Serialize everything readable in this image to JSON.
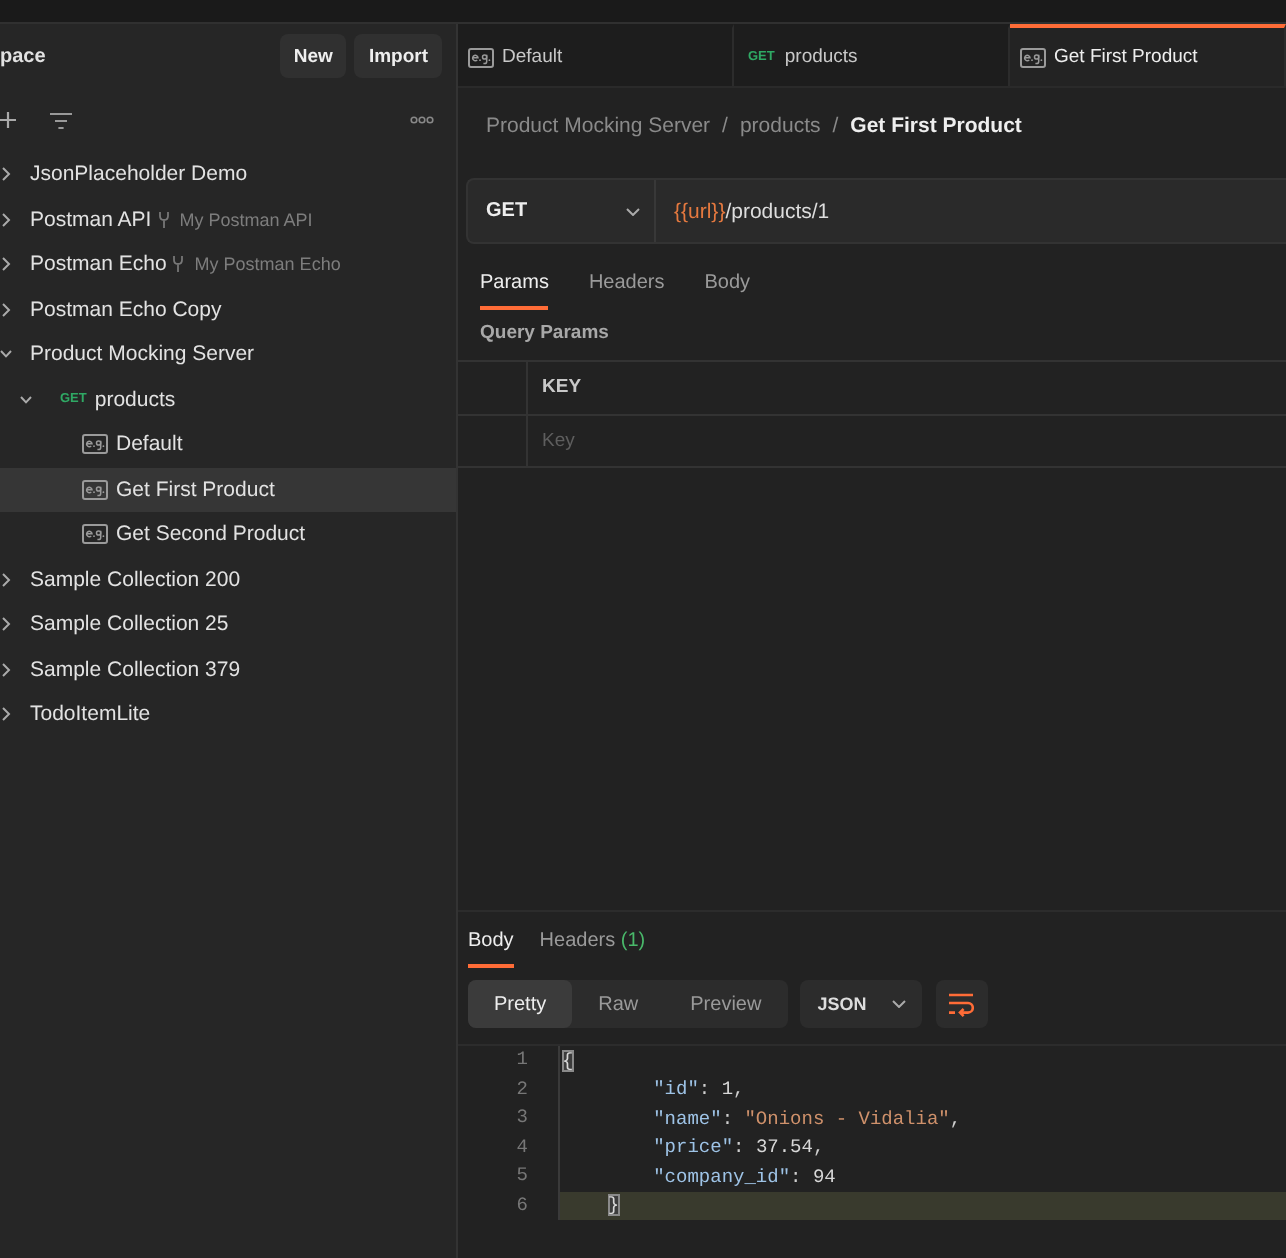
{
  "sidebar": {
    "title": "pace",
    "buttons": [
      "New",
      "Import"
    ],
    "items": [
      {
        "kind": "collection",
        "label": "JsonPlaceholder Demo",
        "expanded": false,
        "selected": false
      },
      {
        "kind": "collection",
        "label": "Postman API",
        "fork_label": "My Postman API",
        "expanded": false,
        "selected": false
      },
      {
        "kind": "collection",
        "label": "Postman Echo",
        "fork_label": "My Postman Echo",
        "expanded": false,
        "selected": false
      },
      {
        "kind": "collection",
        "label": "Postman Echo Copy",
        "expanded": false,
        "selected": false
      },
      {
        "kind": "collection",
        "label": "Product Mocking Server",
        "expanded": true,
        "selected": false,
        "children": [
          {
            "kind": "request",
            "method": "GET",
            "label": "products",
            "expanded": true,
            "selected": false,
            "children": [
              {
                "kind": "example",
                "label": "Default",
                "selected": false
              },
              {
                "kind": "example",
                "label": "Get First Product",
                "selected": true
              },
              {
                "kind": "example",
                "label": "Get Second Product",
                "selected": false
              }
            ]
          }
        ]
      },
      {
        "kind": "collection",
        "label": "Sample Collection 200",
        "expanded": false,
        "selected": false
      },
      {
        "kind": "collection",
        "label": "Sample Collection 25",
        "expanded": false,
        "selected": false
      },
      {
        "kind": "collection",
        "label": "Sample Collection 379",
        "expanded": false,
        "selected": false
      },
      {
        "kind": "collection",
        "label": "TodoItemLite",
        "expanded": false,
        "selected": false
      }
    ]
  },
  "tabs": [
    {
      "kind": "example",
      "label": "Default",
      "selected": false
    },
    {
      "kind": "request",
      "method": "GET",
      "label": "products",
      "selected": false
    },
    {
      "kind": "example",
      "label": "Get First Product",
      "selected": true
    }
  ],
  "breadcrumb": [
    {
      "label": "Product Mocking Server",
      "separator": "/"
    },
    {
      "label": "products",
      "separator": "/"
    },
    {
      "label": "Get First Product"
    }
  ],
  "request": {
    "method": "GET",
    "url": [
      {
        "kind": "variable",
        "text": "{{url}}"
      },
      {
        "kind": "path",
        "text": "/products/1"
      }
    ],
    "tabs": [
      {
        "label": "Params",
        "selected": true
      },
      {
        "label": "Headers",
        "selected": false
      },
      {
        "label": "Body",
        "selected": false
      }
    ],
    "section_title": "Query Params",
    "params_table": {
      "columns": [
        "KEY"
      ],
      "rows": [
        {
          "key_placeholder": "Key"
        }
      ]
    }
  },
  "response": {
    "tabs": [
      {
        "label": "Body",
        "selected": true
      },
      {
        "label": "Headers",
        "count": "(1)",
        "selected": false
      }
    ],
    "views": [
      {
        "label": "Pretty",
        "selected": true
      },
      {
        "label": "Raw",
        "selected": false
      },
      {
        "label": "Preview",
        "selected": false
      }
    ],
    "format": "JSON",
    "wrap_lines": true,
    "code": [
      {
        "number": "1",
        "highlighted": false,
        "tokens": [
          {
            "kind": "bracket",
            "text": "{",
            "matched": true
          }
        ]
      },
      {
        "number": "2",
        "highlighted": false,
        "tokens": [
          {
            "kind": "key",
            "text": "\t\t\"id\""
          },
          {
            "kind": "punct",
            "text": ": "
          },
          {
            "kind": "number",
            "text": "1"
          },
          {
            "kind": "punct",
            "text": ","
          }
        ]
      },
      {
        "number": "3",
        "highlighted": false,
        "tokens": [
          {
            "kind": "key",
            "text": "\t\t\"name\""
          },
          {
            "kind": "punct",
            "text": ": "
          },
          {
            "kind": "string",
            "text": "\"Onions - Vidalia\""
          },
          {
            "kind": "punct",
            "text": ","
          }
        ]
      },
      {
        "number": "4",
        "highlighted": false,
        "tokens": [
          {
            "kind": "key",
            "text": "\t\t\"price\""
          },
          {
            "kind": "punct",
            "text": ": "
          },
          {
            "kind": "number",
            "text": "37.54"
          },
          {
            "kind": "punct",
            "text": ","
          }
        ]
      },
      {
        "number": "5",
        "highlighted": false,
        "tokens": [
          {
            "kind": "key",
            "text": "\t\t\"company_id\""
          },
          {
            "kind": "punct",
            "text": ": "
          },
          {
            "kind": "number",
            "text": "94"
          }
        ]
      },
      {
        "number": "6",
        "highlighted": true,
        "tokens": [
          {
            "kind": "bracket",
            "text": "\t}",
            "matched": true
          }
        ]
      }
    ]
  }
}
